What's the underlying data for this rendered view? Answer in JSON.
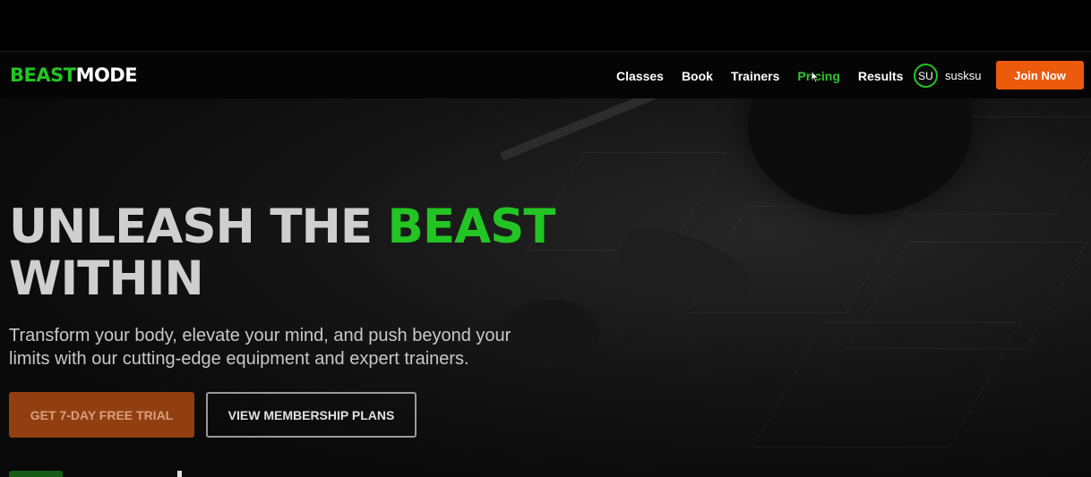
{
  "brand": {
    "part1": "BEAST",
    "part2": "MODE",
    "accent_color": "#22c523"
  },
  "nav": {
    "items": [
      {
        "label": "Classes",
        "active": false
      },
      {
        "label": "Book",
        "active": false
      },
      {
        "label": "Trainers",
        "active": false
      },
      {
        "label": "Pricing",
        "active": true
      },
      {
        "label": "Results",
        "active": false
      }
    ]
  },
  "user": {
    "initials": "SU",
    "name": "susksu"
  },
  "join_label": "Join Now",
  "hero": {
    "line1": "UNLEASH THE ",
    "line1_accent": "BEAST",
    "line2": "WITHIN",
    "subtitle": "Transform your body, elevate your mind, and push beyond your limits with our cutting-edge equipment and expert trainers.",
    "primary_cta": "GET 7-DAY FREE TRIAL",
    "secondary_cta": "VIEW MEMBERSHIP PLANS"
  },
  "colors": {
    "cta_orange": "#ec5a0c",
    "active_nav": "#2fc42f"
  }
}
